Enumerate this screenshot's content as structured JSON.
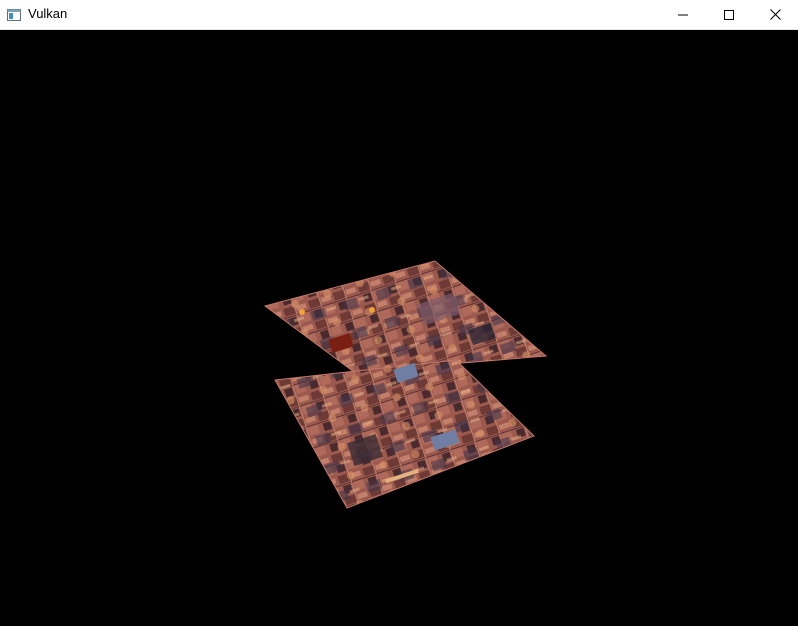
{
  "window": {
    "title": "Vulkan",
    "icon": "app-window-icon",
    "controls": [
      "minimize-icon",
      "maximize-icon",
      "close-icon"
    ]
  },
  "scene": {
    "background": "#000000",
    "objects": [
      {
        "name": "upper-textured-quad",
        "texture": "metal-plate-texture-atlas",
        "tint": "#b56c5d"
      },
      {
        "name": "lower-textured-quad",
        "texture": "metal-plate-texture-atlas",
        "tint": "#b56c5d"
      }
    ]
  }
}
